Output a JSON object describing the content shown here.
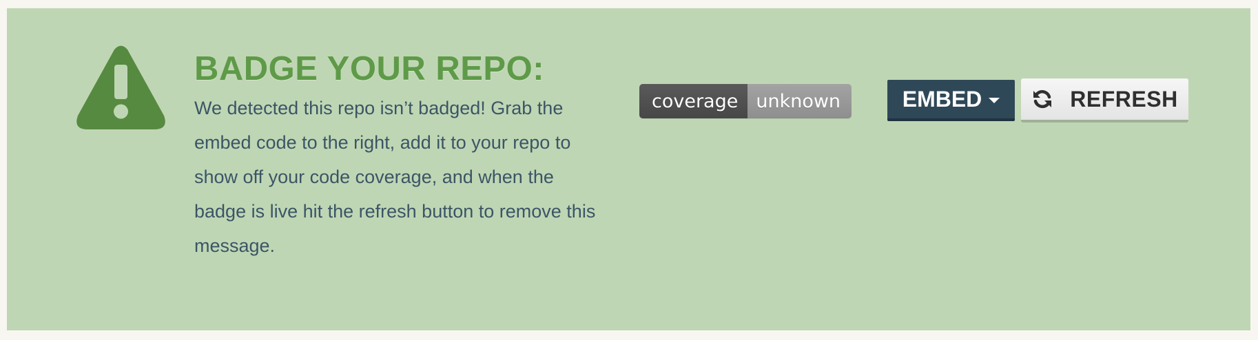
{
  "banner": {
    "icon": "warning-triangle-icon",
    "title": "BADGE YOUR REPO:",
    "message": "We detected this repo isn’t badged! Grab the embed code to the right, add it to your repo to show off your code coverage, and when the badge is live hit the refresh button to remove this message."
  },
  "badge": {
    "label": "coverage",
    "value": "unknown"
  },
  "actions": {
    "embed_label": "EMBED",
    "embed_icon": "caret-down-icon",
    "refresh_label": "REFRESH",
    "refresh_icon": "refresh-icon"
  },
  "colors": {
    "panel_background": "#bfd6b4",
    "accent_green": "#5e9a48",
    "icon_green": "#568a40",
    "text": "#3b5566",
    "embed_button": "#2f4858"
  }
}
